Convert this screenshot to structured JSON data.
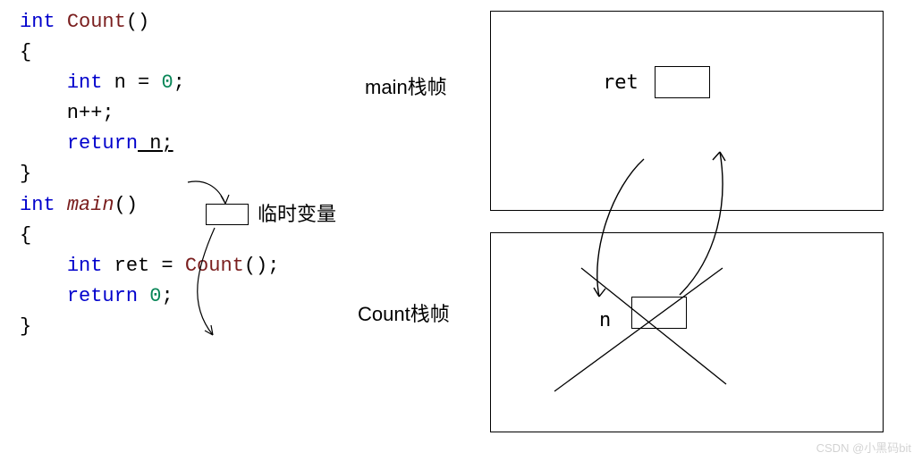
{
  "code": {
    "l1_int": "int ",
    "l1_fn": "Count",
    "l1_rest": "()",
    "l2": "{",
    "l3_pre": "    ",
    "l3_int": "int",
    "l3_mid": " n = ",
    "l3_num": "0",
    "l3_end": ";",
    "l4": "    n++;",
    "l5": "",
    "l6_pre": "    ",
    "l6_ret": "return",
    "l6_rest": " n;",
    "l7": "}",
    "l8": "",
    "l9_int": "int ",
    "l9_fn": "main",
    "l9_rest": "()",
    "l10": "{",
    "l11_pre": "    ",
    "l11_int": "int",
    "l11_mid": " ret = ",
    "l11_fn": "Count",
    "l11_end": "();",
    "l12": "",
    "l13_pre": "    ",
    "l13_ret": "return",
    "l13_mid": " ",
    "l13_num": "0",
    "l13_end": ";",
    "l14": "}"
  },
  "temp_label": "临时变量",
  "frames": {
    "main_label": "main栈帧",
    "count_label": "Count栈帧",
    "ret_var": "ret",
    "n_var": "n"
  },
  "watermark": "CSDN @小黑码bit"
}
